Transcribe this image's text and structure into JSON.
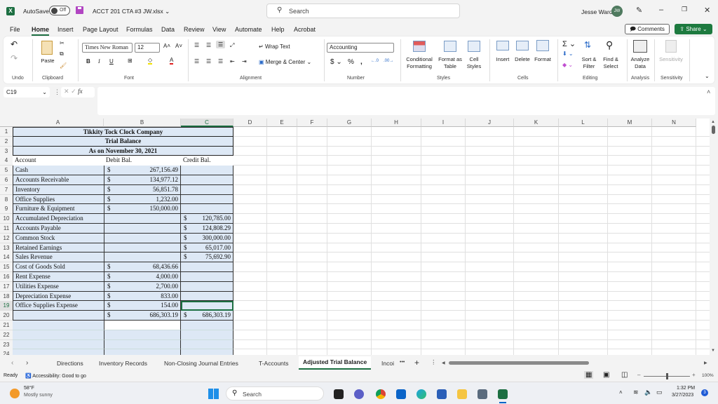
{
  "titlebar": {
    "autosave_label": "AutoSave",
    "autosave_state": "Off",
    "filename": "ACCT 201 CTA #3 JW.xlsx",
    "search_label": "Search",
    "user_name": "Jesse Ward",
    "user_initials": "JW"
  },
  "menu": {
    "tabs": [
      "File",
      "Home",
      "Insert",
      "Page Layout",
      "Formulas",
      "Data",
      "Review",
      "View",
      "Automate",
      "Help",
      "Acrobat"
    ],
    "active": "Home",
    "comments_label": "Comments",
    "share_label": "Share"
  },
  "ribbon": {
    "groups": {
      "undo": "Undo",
      "clipboard": "Clipboard",
      "font": "Font",
      "alignment": "Alignment",
      "number": "Number",
      "styles": "Styles",
      "cells": "Cells",
      "editing": "Editing",
      "analysis": "Analysis",
      "sensitivity": "Sensitivity"
    },
    "paste_label": "Paste",
    "font_name": "Times New Roman",
    "font_size": "12",
    "wrap_text": "Wrap Text",
    "merge_center": "Merge & Center",
    "number_format": "Accounting",
    "conditional_formatting": [
      "Conditional",
      "Formatting"
    ],
    "format_as_table": [
      "Format as",
      "Table"
    ],
    "cell_styles": [
      "Cell",
      "Styles"
    ],
    "insert": "Insert",
    "delete": "Delete",
    "format": "Format",
    "sort_filter": [
      "Sort &",
      "Filter"
    ],
    "find_select": [
      "Find &",
      "Select"
    ],
    "analyze_data": [
      "Analyze",
      "Data"
    ],
    "sensitivity_btn": "Sensitivity"
  },
  "formula_bar": {
    "name_box": "C19",
    "fx": "fx",
    "formula": ""
  },
  "grid": {
    "columns": [
      "A",
      "B",
      "C",
      "D",
      "E",
      "F",
      "G",
      "H",
      "I",
      "J",
      "K",
      "L",
      "M",
      "N"
    ],
    "selected_column": "C",
    "selected_row": 19,
    "title_rows": [
      "Tikkity Tock Clock Company",
      "Trial Balance",
      "As on November 30, 2021"
    ],
    "headers": [
      "Account",
      "Debit Bal.",
      "Credit Bal."
    ],
    "rows": [
      {
        "row": 5,
        "account": "Cash",
        "debit": "267,156.49",
        "credit": ""
      },
      {
        "row": 6,
        "account": "Accounts Receivable",
        "debit": "134,977.12",
        "credit": ""
      },
      {
        "row": 7,
        "account": "Inventory",
        "debit": "56,851.78",
        "credit": ""
      },
      {
        "row": 8,
        "account": "Office Supplies",
        "debit": "1,232.00",
        "credit": ""
      },
      {
        "row": 9,
        "account": "Furniture & Equipment",
        "debit": "150,000.00",
        "credit": ""
      },
      {
        "row": 10,
        "account": "Accumulated Depreciation",
        "debit": "",
        "credit": "120,785.00"
      },
      {
        "row": 11,
        "account": "Accounts Payable",
        "debit": "",
        "credit": "124,808.29"
      },
      {
        "row": 12,
        "account": "Common Stock",
        "debit": "",
        "credit": "300,000.00"
      },
      {
        "row": 13,
        "account": "Retained Earnings",
        "debit": "",
        "credit": "65,017.00"
      },
      {
        "row": 14,
        "account": "Sales Revenue",
        "debit": "",
        "credit": "75,692.90"
      },
      {
        "row": 15,
        "account": "Cost of Goods Sold",
        "debit": "68,436.66",
        "credit": ""
      },
      {
        "row": 16,
        "account": "Rent Expense",
        "debit": "4,000.00",
        "credit": ""
      },
      {
        "row": 17,
        "account": "Utilities Expense",
        "debit": "2,700.00",
        "credit": ""
      },
      {
        "row": 18,
        "account": "Depreciation Expense",
        "debit": "833.00",
        "credit": ""
      },
      {
        "row": 19,
        "account": "Office Supplies Expense",
        "debit": "154.00",
        "credit": ""
      },
      {
        "row": 20,
        "account": "",
        "debit": "686,303.19",
        "credit": "686,303.19"
      }
    ],
    "currency_symbol": "$",
    "row_numbers": [
      1,
      2,
      3,
      4,
      5,
      6,
      7,
      8,
      9,
      10,
      11,
      12,
      13,
      14,
      15,
      16,
      17,
      18,
      19,
      20,
      21,
      22,
      23,
      24
    ]
  },
  "sheets": {
    "tabs": [
      "Directions",
      "Inventory Records",
      "Non-Closing Journal Entries",
      "T-Accounts",
      "Adjusted Trial Balance",
      "Incoi"
    ],
    "active": "Adjusted Trial Balance",
    "more": "•••",
    "add": "+"
  },
  "status": {
    "ready": "Ready",
    "accessibility": "Accessibility: Good to go",
    "zoom": "100%"
  },
  "taskbar": {
    "weather_temp": "58°F",
    "weather_desc": "Mostly sunny",
    "search_label": "Search",
    "time": "1:32 PM",
    "date": "3/27/2023",
    "notification_count": "3"
  },
  "colors": {
    "excel_green": "#1d6f42",
    "table_fill": "#dde8f5",
    "share_green": "#1d7a3f"
  }
}
